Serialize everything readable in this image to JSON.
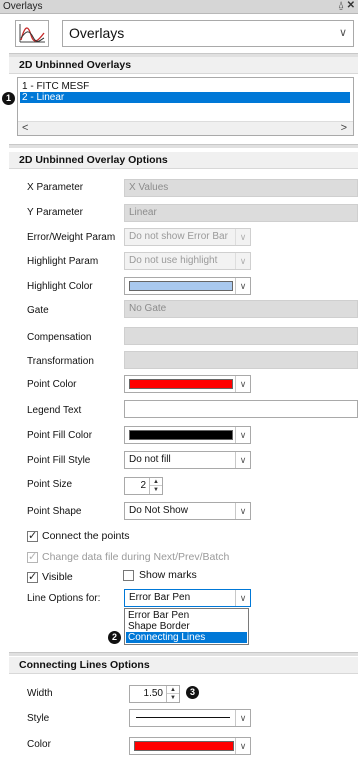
{
  "window": {
    "title": "Overlays",
    "pin_glyph": "⍙",
    "close_glyph": "✕"
  },
  "top": {
    "icon": "overlay-curve-icon",
    "selector_value": "Overlays",
    "chevron": "∨"
  },
  "unbinned_overlays": {
    "header": "2D Unbinned Overlays",
    "items": [
      {
        "label": "1 - FITC MESF",
        "selected": false
      },
      {
        "label": "2 - Linear",
        "selected": true
      }
    ],
    "scroll_left": "<",
    "scroll_right": ">"
  },
  "options": {
    "header": "2D Unbinned Overlay Options",
    "x_parameter": {
      "label": "X Parameter",
      "value": "X Values"
    },
    "y_parameter": {
      "label": "Y Parameter",
      "value": "Linear"
    },
    "error_weight_param": {
      "label": "Error/Weight Param",
      "value": "Do not show Error Bar"
    },
    "highlight_param": {
      "label": "Highlight Param",
      "value": "Do not use highlight"
    },
    "highlight_color": {
      "label": "Highlight Color",
      "color": "#a9c9ef"
    },
    "gate": {
      "label": "Gate",
      "value": "No Gate"
    },
    "compensation": {
      "label": "Compensation",
      "value": ""
    },
    "transformation": {
      "label": "Transformation",
      "value": ""
    },
    "point_color": {
      "label": "Point Color",
      "color": "#ff0000"
    },
    "legend_text": {
      "label": "Legend Text",
      "value": ""
    },
    "point_fill_color": {
      "label": "Point Fill Color",
      "color": "#000000"
    },
    "point_fill_style": {
      "label": "Point Fill Style",
      "value": "Do not fill"
    },
    "point_size": {
      "label": "Point Size",
      "value": "2"
    },
    "point_shape": {
      "label": "Point Shape",
      "value": "Do Not Show"
    },
    "connect_points": {
      "label": "Connect the points",
      "checked": true
    },
    "change_data_file": {
      "label": "Change data file during Next/Prev/Batch",
      "checked": true,
      "disabled": true
    },
    "visible": {
      "label": "Visible",
      "checked": true
    },
    "show_marks": {
      "label": "Show marks",
      "checked": false
    },
    "line_options_for": {
      "label": "Line Options for:",
      "value": "Error Bar Pen",
      "options": [
        "Error Bar Pen",
        "Shape Border",
        "Connecting Lines"
      ],
      "highlighted": "Connecting Lines"
    }
  },
  "connecting_lines": {
    "header": "Connecting Lines Options",
    "width": {
      "label": "Width",
      "value": "1.50"
    },
    "style": {
      "label": "Style"
    },
    "color": {
      "label": "Color",
      "color": "#ff0000"
    }
  },
  "markers": [
    "1",
    "2",
    "3"
  ]
}
